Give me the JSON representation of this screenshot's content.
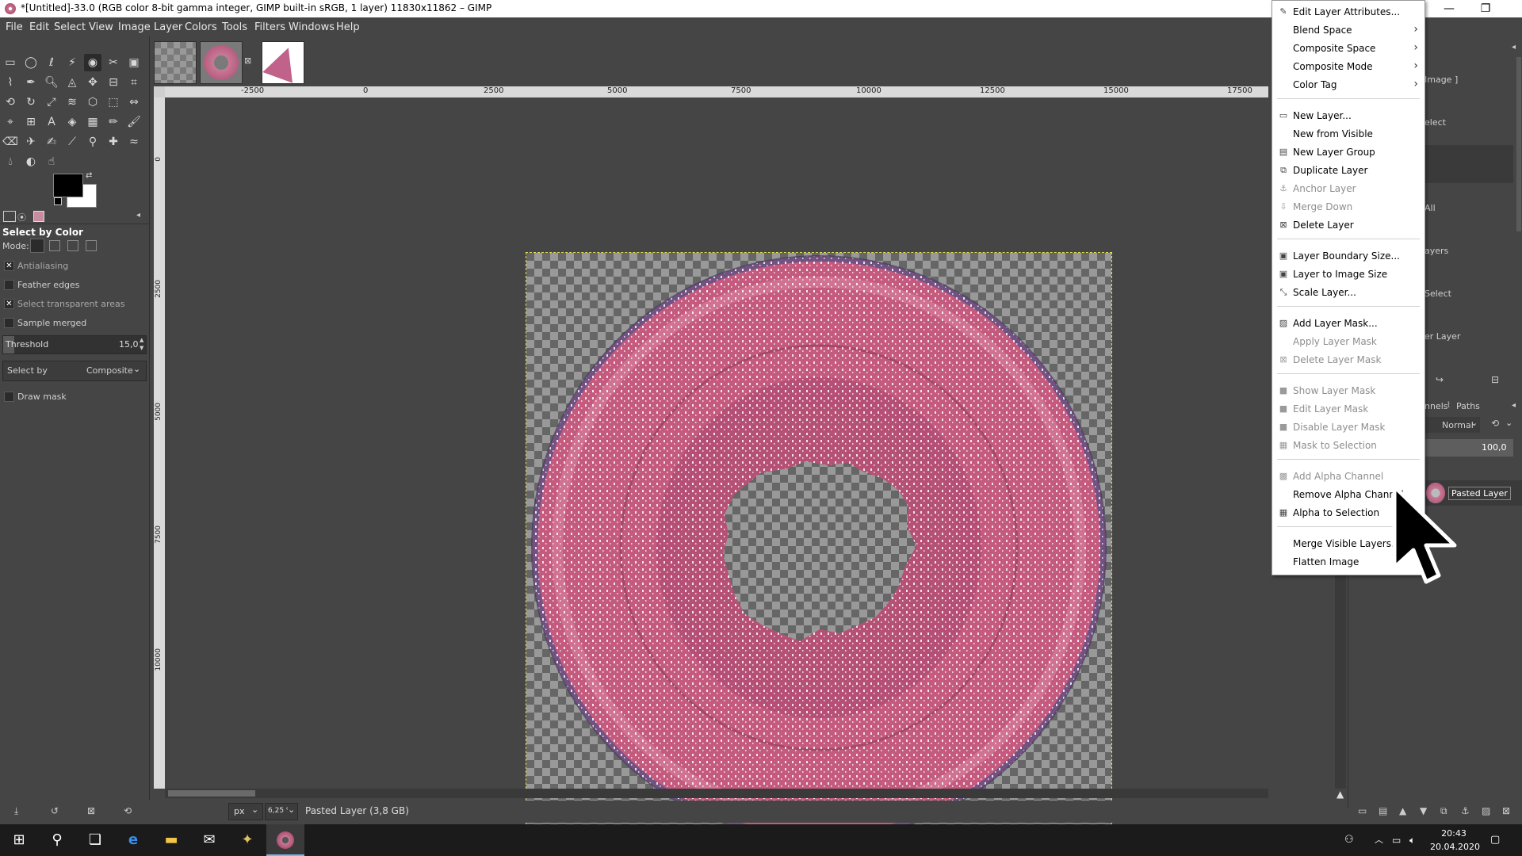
{
  "window": {
    "title": "*[Untitled]-33.0 (RGB color 8-bit gamma integer, GIMP built-in sRGB, 1 layer) 11830x11862 – GIMP",
    "minimize_glyph": "—",
    "maximize_glyph": "❐",
    "close_glyph": "✕"
  },
  "menubar": [
    "File",
    "Edit",
    "Select",
    "View",
    "Image",
    "Layer",
    "Colors",
    "Tools",
    "Filters",
    "Windows",
    "Help"
  ],
  "tool_options": {
    "title": "Select by Color",
    "mode_label": "Mode:",
    "antialiasing": "Antialiasing",
    "feather_edges": "Feather edges",
    "select_transparent": "Select transparent areas",
    "sample_merged": "Sample merged",
    "threshold_label": "Threshold",
    "threshold_value": "15,0",
    "select_by_label": "Select by",
    "select_by_value": "Composite",
    "draw_mask": "Draw mask",
    "check_glyph": "✕"
  },
  "ruler_h": [
    "-2500",
    "0",
    "2500",
    "5000",
    "7500",
    "10000",
    "12500",
    "15000",
    "17500"
  ],
  "ruler_v": [
    "0",
    "2500",
    "5000",
    "7500",
    "10000"
  ],
  "statusbar": {
    "unit": "px",
    "zoom": "6,25 %",
    "layer_info": "Pasted Layer (3,8 GB)"
  },
  "layers_panel": {
    "image_ref": "Image ]",
    "partial_items": [
      "elect",
      "All",
      "ayers",
      "Select",
      "er Layer"
    ],
    "tabs": "nnels",
    "paths_tab": "Paths",
    "mode": "Normal",
    "opacity": "100,0",
    "layer_name": "Pasted Layer"
  },
  "context_menu": {
    "items": [
      {
        "label": "Edit Layer Attributes...",
        "icon": "✎",
        "enabled": true
      },
      {
        "label": "Blend Space",
        "submenu": true,
        "enabled": true
      },
      {
        "label": "Composite Space",
        "submenu": true,
        "enabled": true
      },
      {
        "label": "Composite Mode",
        "submenu": true,
        "enabled": true
      },
      {
        "label": "Color Tag",
        "submenu": true,
        "enabled": true
      },
      {
        "label": "New Layer...",
        "icon": "▭",
        "enabled": true
      },
      {
        "label": "New from Visible",
        "enabled": true
      },
      {
        "label": "New Layer Group",
        "icon": "▤",
        "enabled": true
      },
      {
        "label": "Duplicate Layer",
        "icon": "⧉",
        "enabled": true
      },
      {
        "label": "Anchor Layer",
        "icon": "⚓",
        "enabled": false
      },
      {
        "label": "Merge Down",
        "icon": "⇩",
        "enabled": false
      },
      {
        "label": "Delete Layer",
        "icon": "⊠",
        "enabled": true
      },
      {
        "label": "Layer Boundary Size...",
        "icon": "▣",
        "enabled": true
      },
      {
        "label": "Layer to Image Size",
        "icon": "▣",
        "enabled": true
      },
      {
        "label": "Scale Layer...",
        "icon": "⤡",
        "enabled": true
      },
      {
        "label": "Add Layer Mask...",
        "icon": "▨",
        "enabled": true
      },
      {
        "label": "Apply Layer Mask",
        "enabled": false
      },
      {
        "label": "Delete Layer Mask",
        "icon": "⊠",
        "enabled": false
      },
      {
        "label": "Show Layer Mask",
        "icon": "■",
        "enabled": false
      },
      {
        "label": "Edit Layer Mask",
        "icon": "■",
        "enabled": false
      },
      {
        "label": "Disable Layer Mask",
        "icon": "■",
        "enabled": false
      },
      {
        "label": "Mask to Selection",
        "icon": "▦",
        "enabled": false
      },
      {
        "label": "Add Alpha Channel",
        "icon": "▩",
        "enabled": false
      },
      {
        "label": "Remove Alpha Channel",
        "enabled": true
      },
      {
        "label": "Alpha to Selection",
        "icon": "▦",
        "enabled": true
      },
      {
        "label": "Merge Visible Layers...",
        "enabled": true
      },
      {
        "label": "Flatten Image",
        "enabled": true
      }
    ]
  },
  "taskbar": {
    "time": "20:43",
    "date": "20.04.2020"
  },
  "colors": {
    "accent": "#7fb4e8",
    "specimen_pink": "#c45a7d",
    "specimen_dark": "#8f3a5c"
  }
}
